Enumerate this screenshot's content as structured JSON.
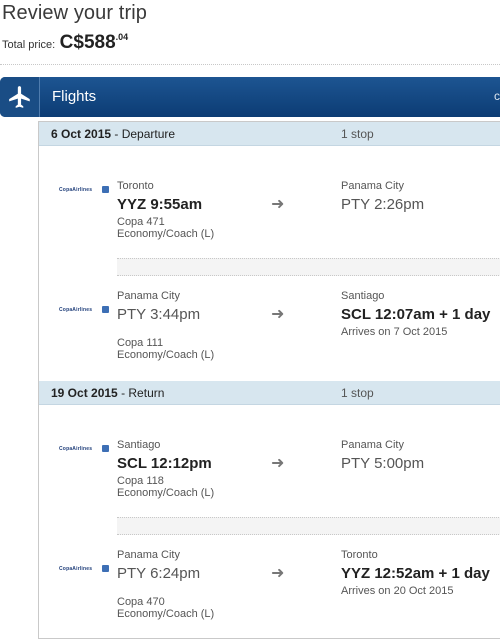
{
  "header": {
    "title": "Review your trip",
    "price_label": "Total price:",
    "price_main": "C$588",
    "price_cents": ".04"
  },
  "flights_bar": {
    "label": "Flights",
    "icon": "airplane-icon",
    "cut_text": "c"
  },
  "legs": [
    {
      "date": "6 Oct 2015",
      "type": "- Departure",
      "stops": "1 stop",
      "segments": [
        {
          "airline_logo": "CopaAirlines",
          "from_city": "Toronto",
          "from_time": "YYZ 9:55am",
          "to_city": "Panama City",
          "to_time": "PTY 2:26pm",
          "flight": "Copa 471",
          "cabin": "Economy/Coach (L)",
          "arrives_note": ""
        },
        {
          "airline_logo": "CopaAirlines",
          "from_city": "Panama City",
          "from_time": "PTY 3:44pm",
          "to_city": "Santiago",
          "to_time": "SCL 12:07am + 1 day",
          "flight": "Copa 111",
          "cabin": "Economy/Coach (L)",
          "arrives_note": "Arrives on 7 Oct 2015"
        }
      ]
    },
    {
      "date": "19 Oct 2015",
      "type": "- Return",
      "stops": "1 stop",
      "segments": [
        {
          "airline_logo": "CopaAirlines",
          "from_city": "Santiago",
          "from_time": "SCL 12:12pm",
          "to_city": "Panama City",
          "to_time": "PTY 5:00pm",
          "flight": "Copa 118",
          "cabin": "Economy/Coach (L)",
          "arrives_note": ""
        },
        {
          "airline_logo": "CopaAirlines",
          "from_city": "Panama City",
          "from_time": "PTY 6:24pm",
          "to_city": "Toronto",
          "to_time": "YYZ 12:52am + 1 day",
          "flight": "Copa 470",
          "cabin": "Economy/Coach (L)",
          "arrives_note": "Arrives on 20 Oct 2015"
        }
      ]
    }
  ]
}
